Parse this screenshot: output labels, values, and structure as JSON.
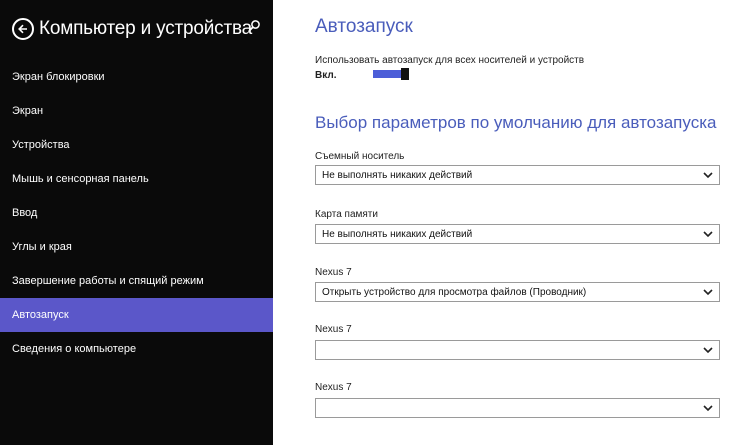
{
  "sidebar": {
    "title": "Компьютер и устройства",
    "items": [
      {
        "label": "Экран блокировки",
        "active": false
      },
      {
        "label": "Экран",
        "active": false
      },
      {
        "label": "Устройства",
        "active": false
      },
      {
        "label": "Мышь и сенсорная панель",
        "active": false
      },
      {
        "label": "Ввод",
        "active": false
      },
      {
        "label": "Углы и края",
        "active": false
      },
      {
        "label": "Завершение работы и спящий режим",
        "active": false
      },
      {
        "label": "Автозапуск",
        "active": true
      },
      {
        "label": "Сведения о компьютере",
        "active": false
      }
    ]
  },
  "main": {
    "heading": "Автозапуск",
    "use_autoplay_label": "Использовать автозапуск для всех носителей и устройств",
    "toggle_state_label": "Вкл.",
    "toggle_on": true,
    "defaults_heading": "Выбор параметров по умолчанию для автозапуска",
    "fields": [
      {
        "label": "Съемный носитель",
        "value": "Не выполнять никаких действий"
      },
      {
        "label": "Карта памяти",
        "value": "Не выполнять никаких действий"
      },
      {
        "label": "Nexus 7",
        "value": "Открыть устройство для просмотра файлов (Проводник)"
      },
      {
        "label": "Nexus 7",
        "value": ""
      },
      {
        "label": "Nexus 7",
        "value": ""
      }
    ]
  },
  "colors": {
    "sidebar_bg": "#0a0a0a",
    "accent": "#5b57c9",
    "heading": "#4a5dbb",
    "toggle": "#4c5ed8"
  },
  "icons": {
    "back": "back-arrow-icon",
    "search": "search-icon",
    "dropdown": "chevron-down-icon"
  }
}
